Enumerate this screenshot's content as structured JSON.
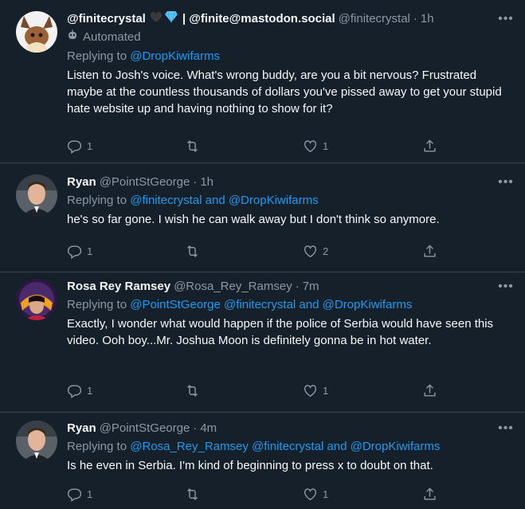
{
  "tweets": [
    {
      "name": "@finitecrystal",
      "name_suffix": "| @finite@mastodon.social",
      "handle": "@finitecrystal",
      "time": "1h",
      "automated_label": "Automated",
      "replying_prefix": "Replying to",
      "replying_to": "@DropKiwifarms",
      "text": "Listen to Josh's voice. What's wrong buddy, are you a bit nervous? Frustrated maybe at the countless thousands of dollars you've pissed away to get your stupid hate website up and having nothing to show for it?",
      "replies": "1",
      "retweets": "",
      "likes": "1"
    },
    {
      "name": "Ryan",
      "handle": "@PointStGeorge",
      "time": "1h",
      "replying_prefix": "Replying to",
      "replying_to": "@finitecrystal and @DropKiwifarms",
      "text": "he's so far gone. I wish he can walk away but I don't think so anymore.",
      "replies": "1",
      "retweets": "",
      "likes": "2"
    },
    {
      "name": "Rosa Rey Ramsey",
      "handle": "@Rosa_Rey_Ramsey",
      "time": "7m",
      "replying_prefix": "Replying to",
      "replying_to": "@PointStGeorge @finitecrystal and @DropKiwifarms",
      "text": "Exactly, I wonder what would happen if the police of Serbia would have seen this video. Ooh boy...Mr. Joshua Moon is definitely gonna be in hot water.",
      "replies": "1",
      "retweets": "",
      "likes": "1"
    },
    {
      "name": "Ryan",
      "handle": "@PointStGeorge",
      "time": "4m",
      "replying_prefix": "Replying to",
      "replying_to": "@Rosa_Rey_Ramsey @finitecrystal and @DropKiwifarms",
      "text": "Is he even in Serbia. I'm kind of beginning to press x to doubt on that.",
      "replies": "1",
      "retweets": "",
      "likes": "1"
    }
  ],
  "time_separator": "·",
  "more_glyph": "•••",
  "colors": {
    "background": "#15202b",
    "text": "#f7f9f9",
    "muted": "#8b98a5",
    "link": "#1d9bf0",
    "border": "#38444d"
  },
  "icons": [
    "reply-icon",
    "retweet-icon",
    "like-icon",
    "share-icon",
    "more-icon",
    "robot-icon",
    "black-heart-icon",
    "diamond-icon"
  ]
}
